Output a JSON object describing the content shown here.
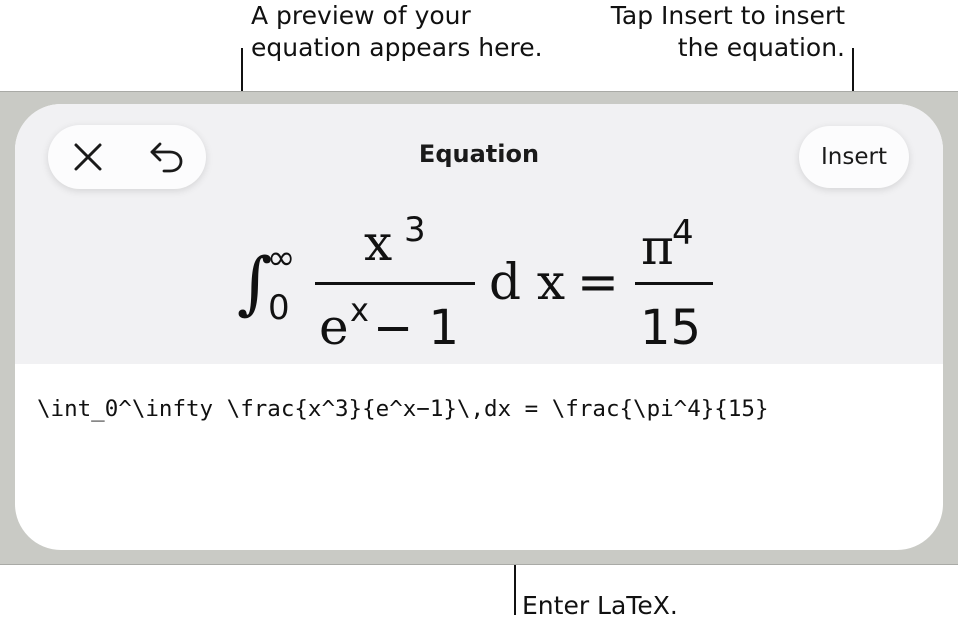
{
  "callouts": {
    "preview": [
      "A preview of your",
      "equation appears here."
    ],
    "insert": [
      "Tap Insert to insert",
      "the equation."
    ],
    "latex": "Enter LaTeX."
  },
  "editor": {
    "title": "Equation",
    "insert_label": "Insert",
    "close_icon": "close-icon",
    "undo_icon": "undo-icon",
    "latex_input": "\\int_0^\\infty \\frac{x^3}{e^x−1}\\,dx = \\frac{\\pi^4}{15}",
    "preview": {
      "integral": "∫",
      "upper": "∞",
      "lower": "0",
      "num_base": "x",
      "num_exp": "3",
      "den_base": "e",
      "den_exp": "x",
      "den_rest": "− 1",
      "dx": "d x",
      "equals": "=",
      "rhs_num_base": "π",
      "rhs_num_exp": "4",
      "rhs_den": "15"
    }
  }
}
